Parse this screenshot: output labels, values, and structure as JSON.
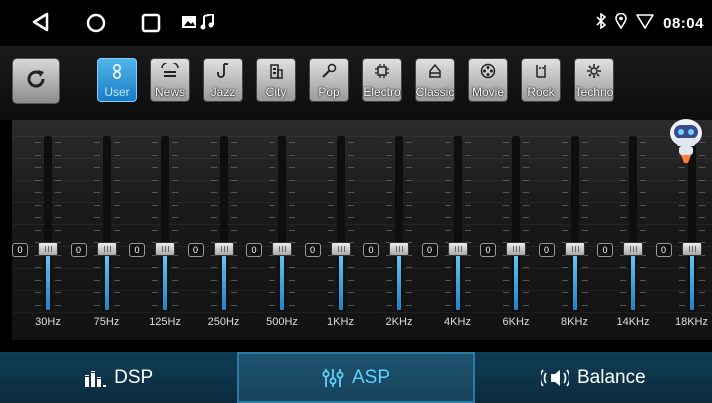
{
  "status_bar": {
    "time": "08:04",
    "icons": [
      "back-triangle-icon",
      "home-circle-icon",
      "recents-square-icon",
      "image-icon",
      "music-note-icon",
      "bluetooth-icon",
      "location-icon",
      "wifi-icon"
    ]
  },
  "presets": {
    "items": [
      {
        "label": "User",
        "icon": "user-icon",
        "active": true
      },
      {
        "label": "News",
        "icon": "news-icon",
        "active": false
      },
      {
        "label": "Jazz",
        "icon": "saxophone-icon",
        "active": false
      },
      {
        "label": "City",
        "icon": "city-icon",
        "active": false
      },
      {
        "label": "Pop",
        "icon": "microphone-icon",
        "active": false
      },
      {
        "label": "Electro",
        "icon": "chip-icon",
        "active": false
      },
      {
        "label": "Classic",
        "icon": "piano-icon",
        "active": false
      },
      {
        "label": "Movie",
        "icon": "film-reel-icon",
        "active": false
      },
      {
        "label": "Rock",
        "icon": "rock-hand-icon",
        "active": false
      },
      {
        "label": "Techno",
        "icon": "gear-icon",
        "active": false
      }
    ]
  },
  "equalizer": {
    "bands": [
      {
        "freq": "30Hz",
        "value": "0"
      },
      {
        "freq": "75Hz",
        "value": "0"
      },
      {
        "freq": "125Hz",
        "value": "0"
      },
      {
        "freq": "250Hz",
        "value": "0"
      },
      {
        "freq": "500Hz",
        "value": "0"
      },
      {
        "freq": "1KHz",
        "value": "0"
      },
      {
        "freq": "2KHz",
        "value": "0"
      },
      {
        "freq": "4KHz",
        "value": "0"
      },
      {
        "freq": "6KHz",
        "value": "0"
      },
      {
        "freq": "8KHz",
        "value": "0"
      },
      {
        "freq": "14KHz",
        "value": "0"
      },
      {
        "freq": "18KHz",
        "value": "0"
      }
    ]
  },
  "bottom_nav": {
    "tabs": [
      {
        "label": "DSP",
        "icon": "equalizer-bars-icon",
        "active": false
      },
      {
        "label": "ASP",
        "icon": "sliders-icon",
        "active": true
      },
      {
        "label": "Balance",
        "icon": "speaker-icon",
        "active": false
      }
    ]
  },
  "colors": {
    "accent": "#35b3ea",
    "nav_background": "#0f3e57",
    "active_preset": "#2a95d6"
  }
}
